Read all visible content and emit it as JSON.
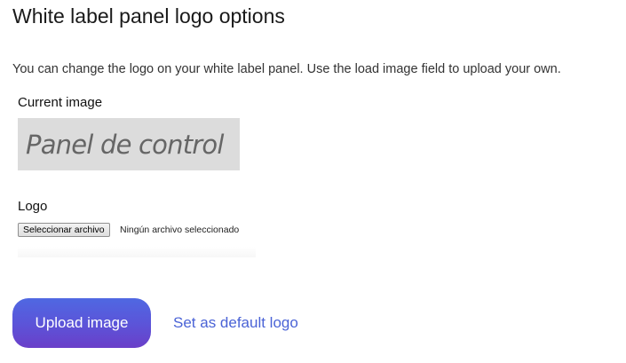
{
  "page": {
    "title": "White label panel logo options",
    "description": "You can change the logo on your white label panel. Use the load image field to upload your own."
  },
  "current_image": {
    "label": "Current image",
    "logo_text": "Panel de control"
  },
  "logo_field": {
    "label": "Logo",
    "button_label": "Seleccionar archivo",
    "status": "Ningún archivo seleccionado"
  },
  "actions": {
    "upload_label": "Upload image",
    "default_label": "Set as default logo"
  },
  "colors": {
    "accent": "#4a63d6",
    "button_gradient_start": "#4f68e2",
    "button_gradient_end": "#6a3fc9",
    "preview_bg": "#dcdcdc"
  }
}
